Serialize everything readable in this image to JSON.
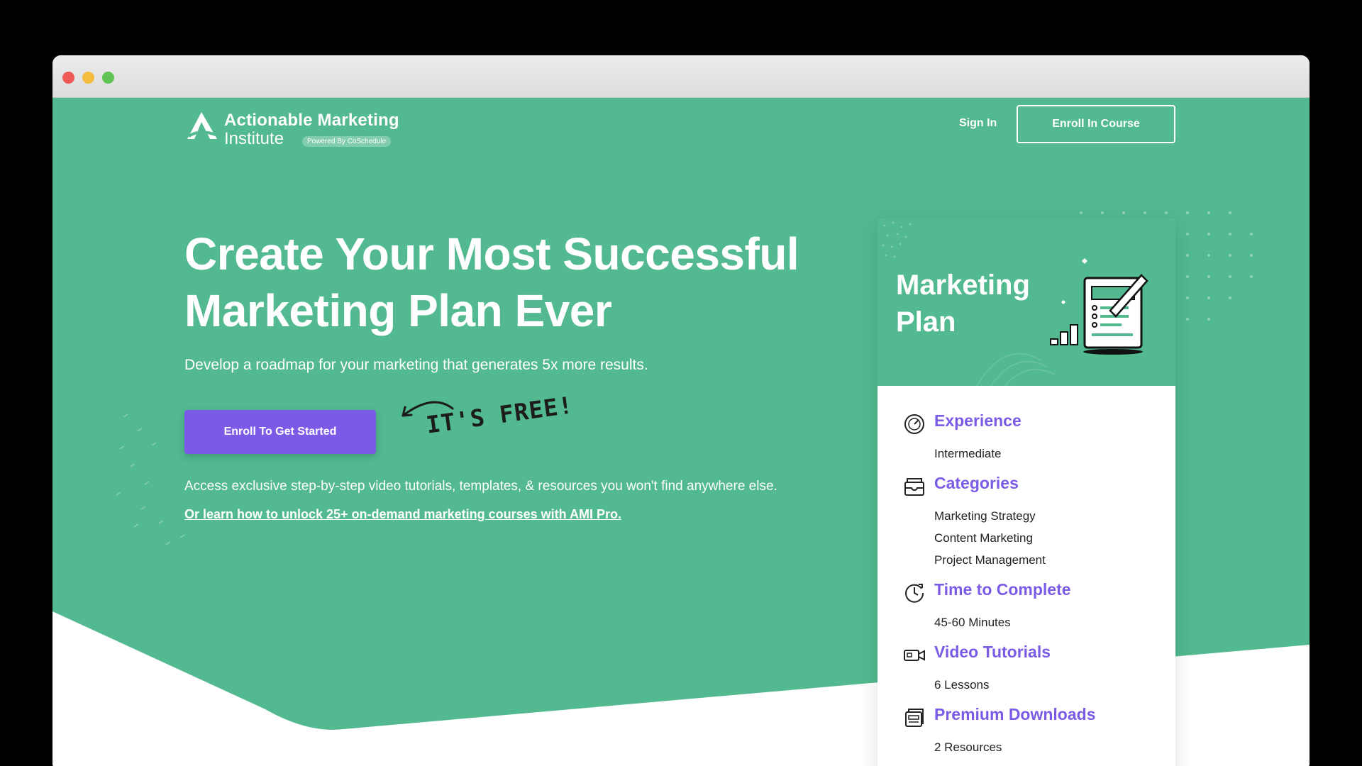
{
  "header": {
    "logo_title": "Actionable Marketing",
    "logo_sub": "Institute",
    "logo_badge": "Powered By CoSchedule",
    "signin_label": "Sign In",
    "enroll_course_label": "Enroll In Course"
  },
  "hero": {
    "headline_line1": "Create Your Most Successful",
    "headline_line2": "Marketing Plan Ever",
    "subhead": "Develop a roadmap for your marketing that generates 5x more results.",
    "cta_label": "Enroll To Get Started",
    "free_note": "IT'S FREE!",
    "access_text": "Access exclusive step-by-step video tutorials, templates, & resources you won't find anywhere else.",
    "pro_link": "Or learn how to unlock 25+ on-demand marketing courses with AMI Pro."
  },
  "card": {
    "title_line1": "Marketing",
    "title_line2": "Plan",
    "features": [
      {
        "icon": "gauge-icon",
        "title": "Experience",
        "values": [
          "Intermediate"
        ]
      },
      {
        "icon": "folder-icon",
        "title": "Categories",
        "values": [
          "Marketing Strategy",
          "Content Marketing",
          "Project Management"
        ]
      },
      {
        "icon": "clock-icon",
        "title": "Time to Complete",
        "values": [
          "45-60 Minutes"
        ]
      },
      {
        "icon": "video-camera-icon",
        "title": "Video Tutorials",
        "values": [
          "6 Lessons"
        ]
      },
      {
        "icon": "downloads-icon",
        "title": "Premium Downloads",
        "values": [
          "2 Resources"
        ]
      }
    ]
  },
  "colors": {
    "brand_green": "#52b990",
    "accent_purple": "#7b5be6",
    "white": "#ffffff"
  }
}
